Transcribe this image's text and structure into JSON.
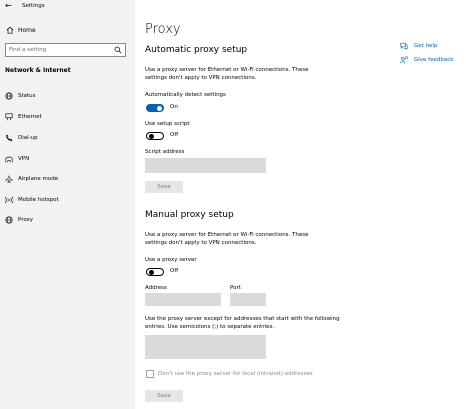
{
  "app": {
    "title": "Settings"
  },
  "sidebar": {
    "home_label": "Home",
    "search_placeholder": "Find a setting",
    "section_title": "Network & Internet",
    "items": [
      {
        "label": "Status",
        "icon": "globe-icon"
      },
      {
        "label": "Ethernet",
        "icon": "ethernet-icon"
      },
      {
        "label": "Dial-up",
        "icon": "phone-icon"
      },
      {
        "label": "VPN",
        "icon": "vpn-icon"
      },
      {
        "label": "Airplane mode",
        "icon": "airplane-icon"
      },
      {
        "label": "Mobile hotspot",
        "icon": "hotspot-icon"
      },
      {
        "label": "Proxy",
        "icon": "globe-icon"
      }
    ]
  },
  "main": {
    "title": "Proxy",
    "automatic": {
      "heading": "Automatic proxy setup",
      "desc": "Use a proxy server for Ethernet or Wi-Fi connections. These settings don't apply to VPN connections.",
      "detect_label": "Automatically detect settings",
      "detect_state": "On",
      "script_label": "Use setup script",
      "script_state": "Off",
      "script_address_label": "Script address",
      "save_label": "Save"
    },
    "manual": {
      "heading": "Manual proxy setup",
      "desc": "Use a proxy server for Ethernet or Wi-Fi connections. These settings don't apply to VPN connections.",
      "use_proxy_label": "Use a proxy server",
      "use_proxy_state": "Off",
      "address_label": "Address",
      "port_label": "Port",
      "exceptions_desc": "Use the proxy server except for addresses that start with the following entries. Use semicolons (;) to separate entries.",
      "local_label": "Don't use the proxy server for local (intranet) addresses",
      "save_label": "Save"
    }
  },
  "help": {
    "get_help": "Get help",
    "feedback": "Give feedback"
  },
  "colors": {
    "accent": "#0063b1",
    "sidebar_bg": "#f2f2f2",
    "field_bg": "#dadada"
  }
}
